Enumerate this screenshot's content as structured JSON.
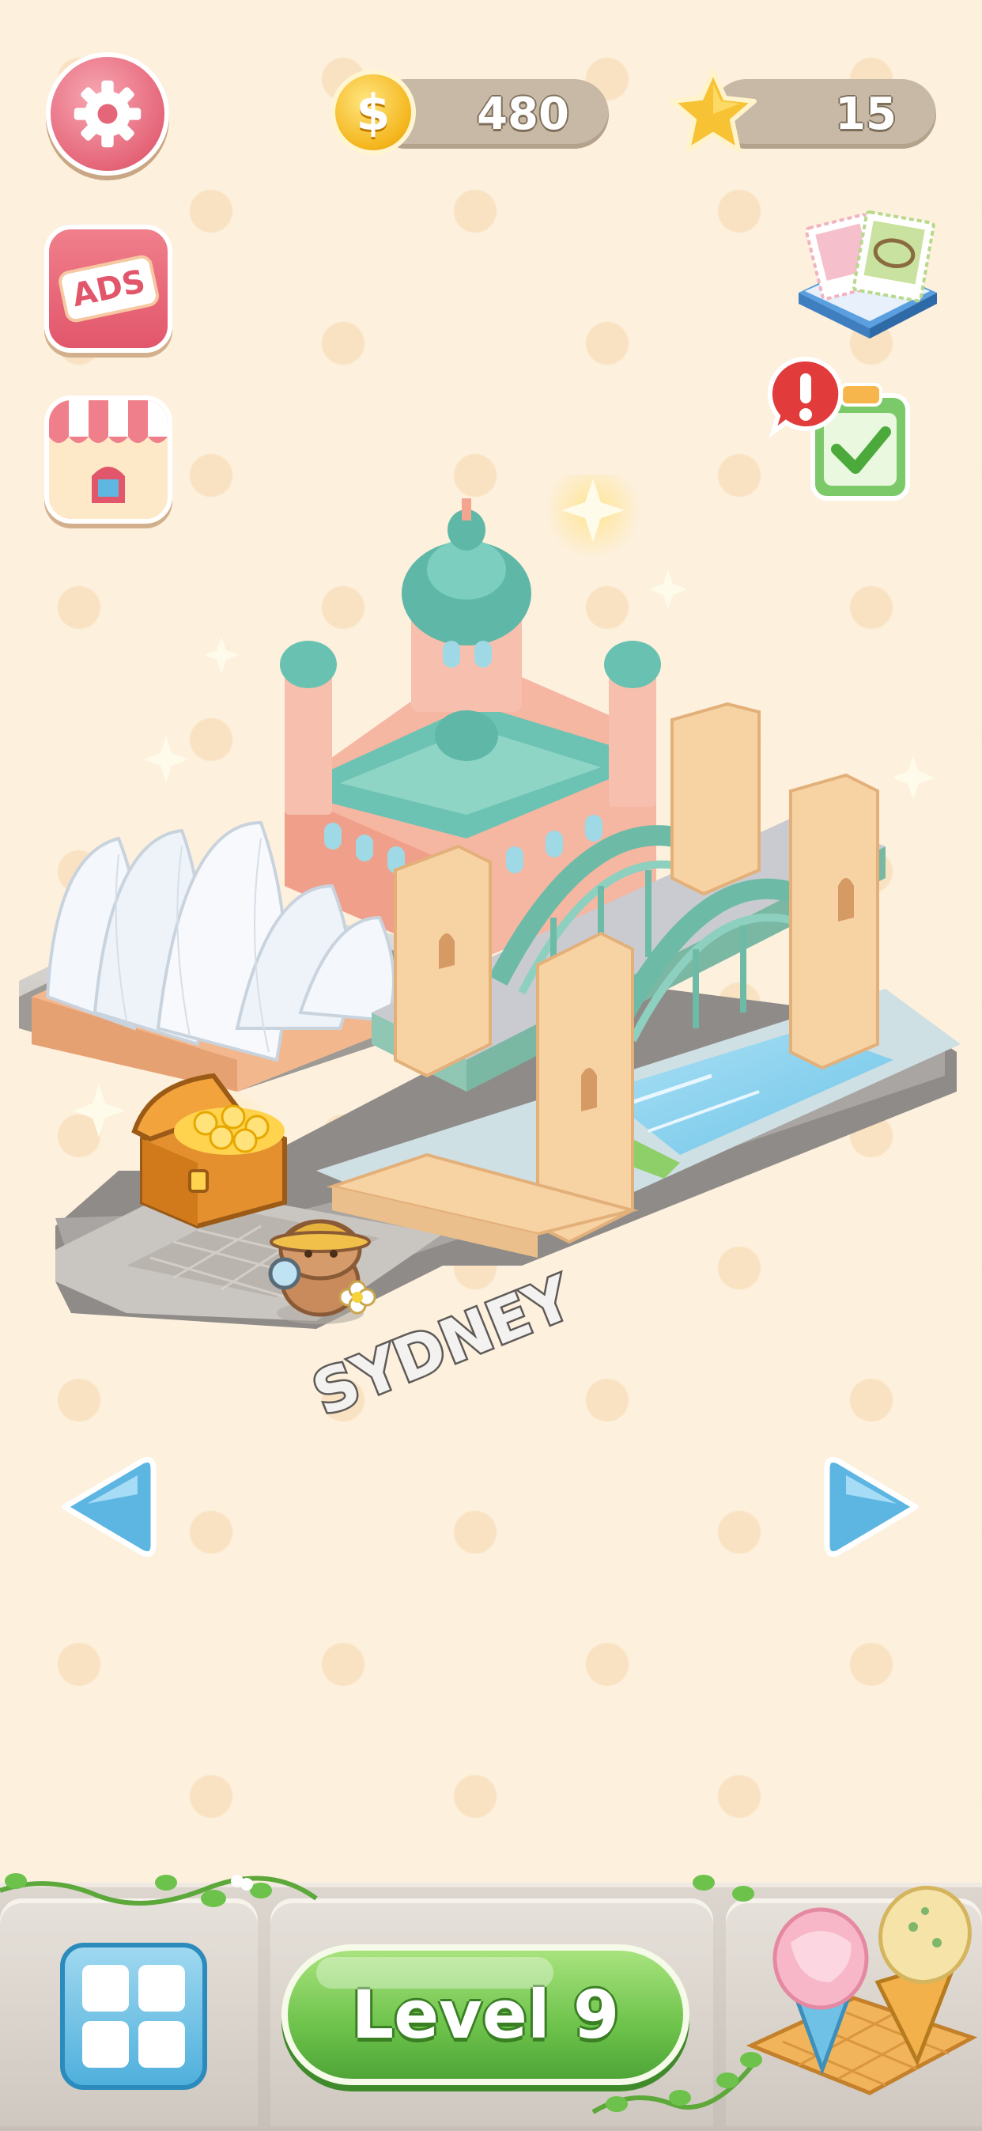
{
  "hud": {
    "coins": "480",
    "stars": "15",
    "coin_symbol": "$"
  },
  "buttons": {
    "ads_label": "ADS",
    "level_label": "Level 9"
  },
  "scene": {
    "city_label": "SYDNEY",
    "landmarks": [
      "Sydney Opera House",
      "Queen Victoria Building",
      "Sydney Harbour Bridge"
    ]
  },
  "icons": {
    "settings": "gear-icon",
    "ads": "ads-icon",
    "shop": "shop-icon",
    "coin": "coin-icon",
    "star": "star-icon",
    "album": "stamp-album-icon",
    "tasks": "task-checklist-icon",
    "alert": "alert-badge-icon",
    "chest": "treasure-chest-icon",
    "mascot": "capybara-mascot-icon",
    "prev": "arrow-left-icon",
    "next": "arrow-right-icon",
    "menu": "grid-menu-icon",
    "treat": "ice-cream-icon"
  },
  "colors": {
    "background": "#fdf0dd",
    "level_button": "#6cc24a",
    "settings_button": "#e56679",
    "arrow": "#4fb0dc"
  }
}
